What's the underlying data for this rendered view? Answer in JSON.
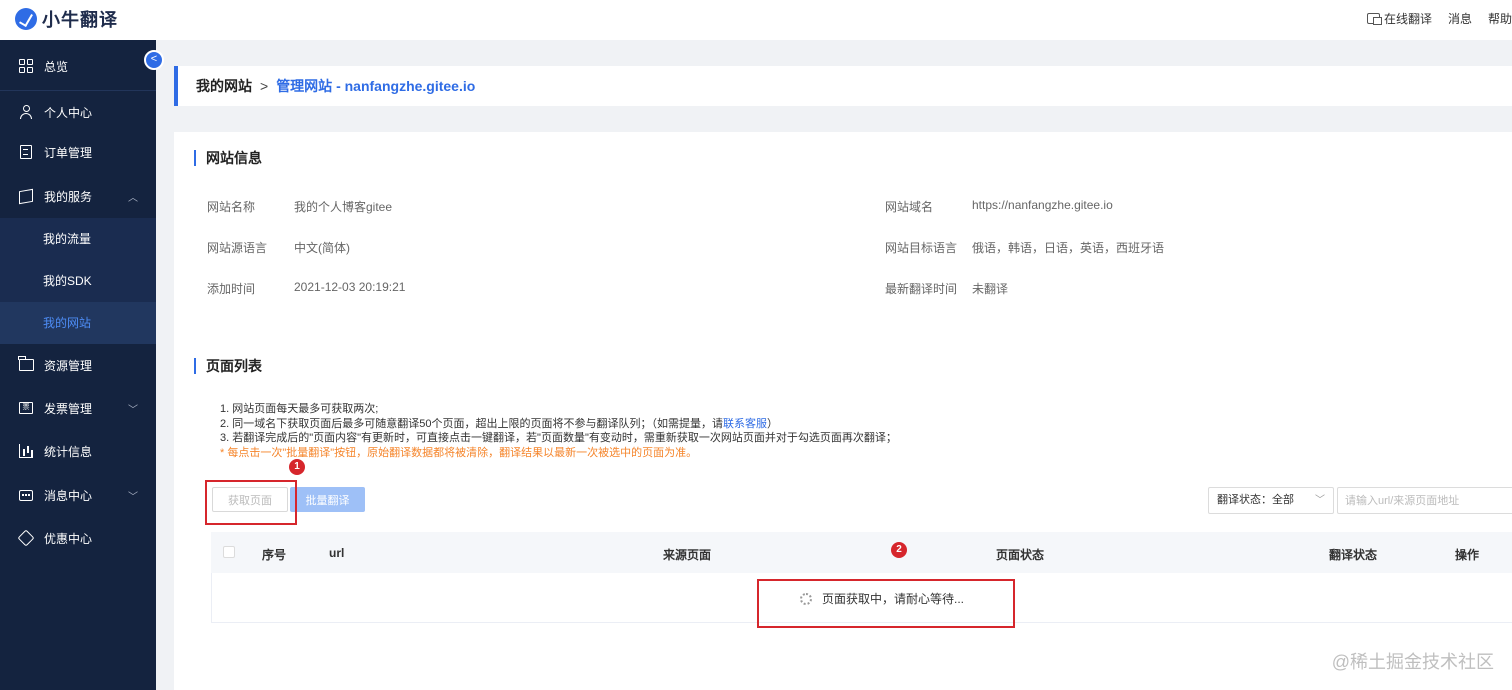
{
  "app": {
    "logo_text": "小牛翻译"
  },
  "topbar": {
    "online_translate": "在线翻译",
    "messages": "消息",
    "help": "帮助"
  },
  "sidebar": {
    "collapse_glyph": "<",
    "items": [
      {
        "label": "总览",
        "icon": "grid-icon"
      },
      {
        "label": "个人中心",
        "icon": "user-icon"
      },
      {
        "label": "订单管理",
        "icon": "document-icon"
      },
      {
        "label": "我的服务",
        "icon": "box-icon",
        "expanded": true
      },
      {
        "label": "资源管理",
        "icon": "folder-icon"
      },
      {
        "label": "发票管理",
        "icon": "invoice-icon"
      },
      {
        "label": "统计信息",
        "icon": "chart-icon"
      },
      {
        "label": "消息中心",
        "icon": "message-icon"
      },
      {
        "label": "优惠中心",
        "icon": "tag-icon"
      }
    ],
    "subitems": [
      {
        "label": "我的流量"
      },
      {
        "label": "我的SDK"
      },
      {
        "label": "我的网站",
        "active": true
      }
    ]
  },
  "breadcrumb": {
    "first": "我的网站",
    "separator": ">",
    "current": "管理网站 - nanfangzhe.gitee.io"
  },
  "site_info": {
    "title": "网站信息",
    "name_label": "网站名称",
    "name_value": "我的个人博客gitee",
    "domain_label": "网站域名",
    "domain_value": "https://nanfangzhe.gitee.io",
    "source_lang_label": "网站源语言",
    "source_lang_value": "中文(简体)",
    "target_lang_label": "网站目标语言",
    "target_lang_value": "俄语，韩语，日语，英语，西班牙语",
    "added_label": "添加时间",
    "added_value": "2021-12-03 20:19:21",
    "last_translate_label": "最新翻译时间",
    "last_translate_value": "未翻译"
  },
  "page_list": {
    "title": "页面列表",
    "note1": "1. 网站页面每天最多可获取两次;",
    "note2_prefix": "2. 同一域名下获取页面后最多可随意翻译50个页面，超出上限的页面将不参与翻译队列；（如需提量，请",
    "note2_link": "联系客服",
    "note2_suffix": "）",
    "note3": "3. 若翻译完成后的\"页面内容\"有更新时，可直接点击一键翻译，若\"页面数量\"有变动时，需重新获取一次网站页面并对于勾选页面再次翻译；",
    "warning": "* 每点击一次\"批量翻译\"按钮，原始翻译数据都将被清除，翻译结果以最新一次被选中的页面为准。",
    "fetch_button": "获取页面",
    "batch_button": "批量翻译",
    "status_filter": "翻译状态：全部",
    "search_placeholder": "请输入url/来源页面地址",
    "columns": [
      "序号",
      "url",
      "来源页面",
      "页面状态",
      "翻译状态",
      "操作"
    ],
    "loading_text": "页面获取中，请耐心等待..."
  },
  "annotations": {
    "one": "1",
    "two": "2"
  },
  "watermark": "@稀土掘金技术社区"
}
